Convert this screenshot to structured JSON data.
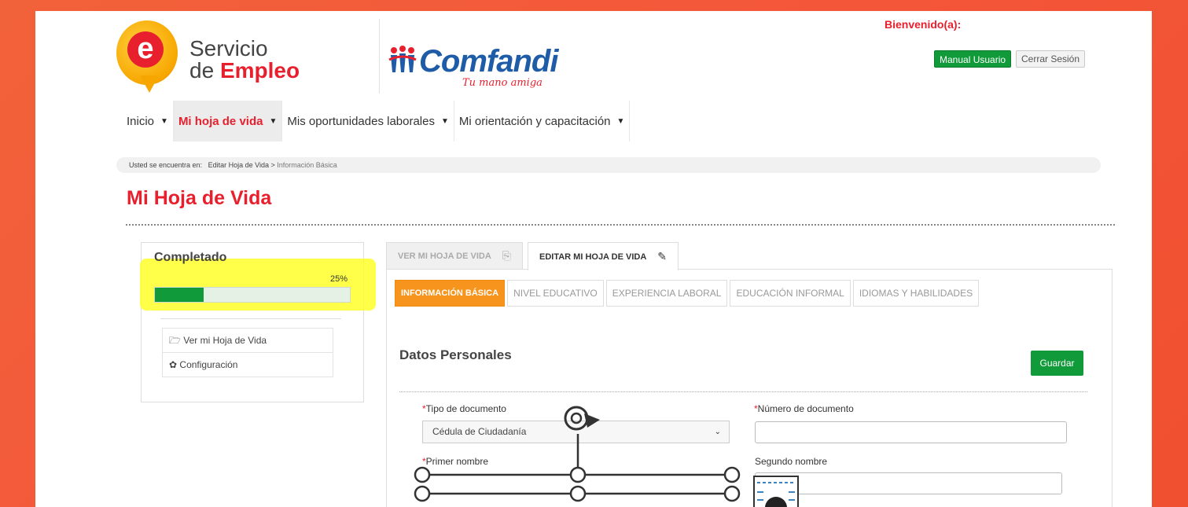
{
  "header": {
    "logo_word1": "Servicio",
    "logo_word2a": "de",
    "logo_word2b": "Empleo",
    "logo_letter": "e",
    "partner_name": "Comfandi",
    "partner_tagline": "Tu mano amiga",
    "welcome": "Bienvenido(a):",
    "manual_button": "Manual Usuario",
    "logout_button": "Cerrar Sesión"
  },
  "nav": {
    "items": [
      {
        "label": "Inicio"
      },
      {
        "label": "Mi hoja de vida"
      },
      {
        "label": "Mis oportunidades laborales"
      },
      {
        "label": "Mi orientación y capacitación"
      }
    ]
  },
  "breadcrumb": {
    "prefix": "Usted se encuentra en:",
    "path": "Editar Hoja de Vida",
    "sep": ">",
    "current": "Información Básica"
  },
  "page_title": "Mi Hoja de Vida",
  "progress": {
    "title": "Completado",
    "percent_label": "25%",
    "percent": 25,
    "links": [
      {
        "icon": "folder-open-icon",
        "label": "Ver mi Hoja de Vida"
      },
      {
        "icon": "gear-icon",
        "label": "Configuración"
      }
    ]
  },
  "tabs": [
    {
      "label": "VER MI HOJA DE VIDA",
      "icon": "search-doc-icon"
    },
    {
      "label": "EDITAR MI HOJA DE VIDA",
      "icon": "edit-icon"
    }
  ],
  "subtabs": [
    "INFORMACIÓN BÁSICA",
    "NIVEL EDUCATIVO",
    "EXPERIENCIA LABORAL",
    "EDUCACIÓN INFORMAL",
    "IDIOMAS Y HABILIDADES"
  ],
  "form": {
    "section_title": "Datos Personales",
    "save_button": "Guardar",
    "required_mark": "*",
    "doc_type_label": "Tipo de documento",
    "doc_type_value": "Cédula de Ciudadanía",
    "doc_number_label": "Número de documento",
    "first_name_label": "Primer nombre",
    "second_name_label": "Segundo nombre"
  },
  "colors": {
    "accent_red": "#e8202e",
    "brand_green": "#119a3a",
    "orange_tab": "#f7941d",
    "background_orange": "#f2583a",
    "highlight_yellow": "#ffff2a"
  }
}
